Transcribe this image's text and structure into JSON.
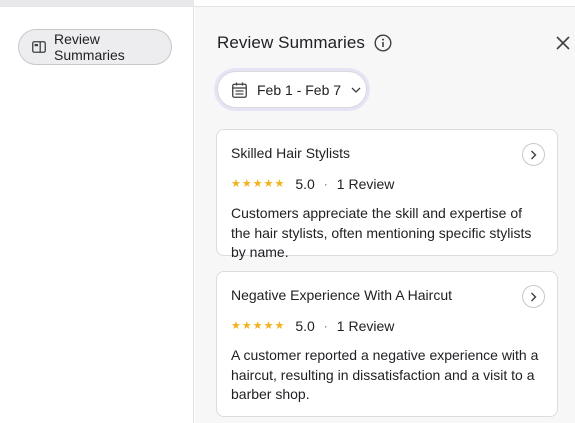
{
  "left_panel": {
    "chip_label": "Review Summaries"
  },
  "panel": {
    "title": "Review Summaries",
    "date_range": "Feb 1 - Feb 7"
  },
  "cards": [
    {
      "title": "Skilled Hair Stylists",
      "rating": "5.0",
      "stars": "★★★★★",
      "separator": "·",
      "reviews": "1 Review",
      "description": "Customers appreciate the skill and expertise of the hair stylists, often mentioning specific stylists by name."
    },
    {
      "title": "Negative Experience With A Haircut",
      "rating": "5.0",
      "stars": "★★★★★",
      "separator": "·",
      "reviews": "1 Review",
      "description": "A customer reported a negative experience with a haircut, resulting in dissatisfaction and a visit to a barber shop."
    }
  ],
  "colors": {
    "star": "#f2b21b",
    "chip_focus_ring": "#e6e4f4",
    "panel_bg": "#f7f7f8"
  }
}
